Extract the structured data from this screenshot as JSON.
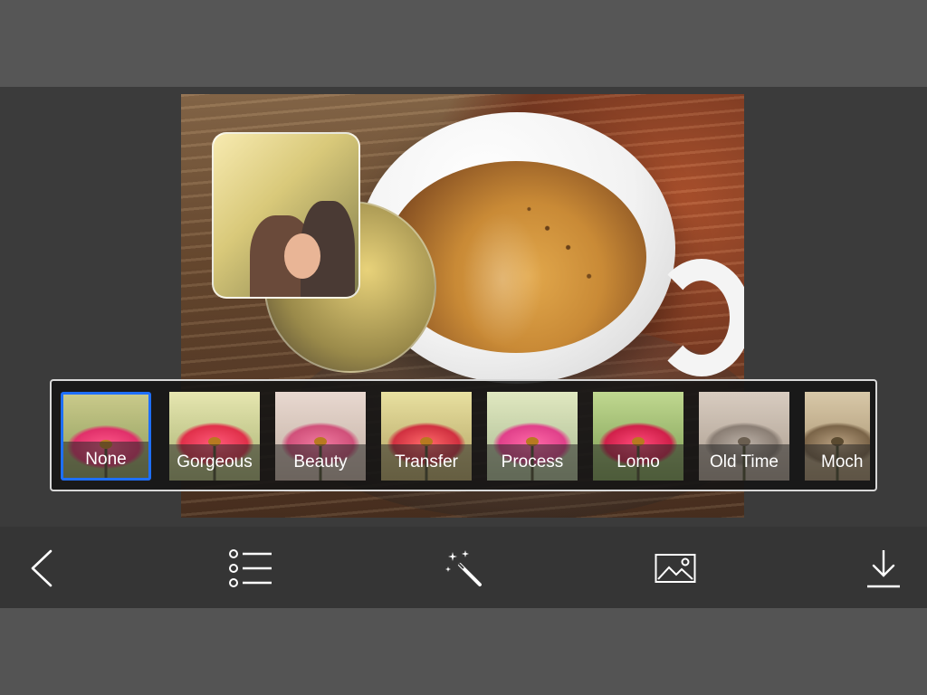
{
  "filters": [
    {
      "label": "None",
      "selected": true
    },
    {
      "label": "Gorgeous",
      "selected": false
    },
    {
      "label": "Beauty",
      "selected": false
    },
    {
      "label": "Transfer",
      "selected": false
    },
    {
      "label": "Process",
      "selected": false
    },
    {
      "label": "Lomo",
      "selected": false
    },
    {
      "label": "Old Time",
      "selected": false
    },
    {
      "label": "Moch",
      "selected": false
    }
  ],
  "toolbar": {
    "back": "back-arrow-icon",
    "list": "list-icon",
    "effects": "magic-wand-icon",
    "gallery": "image-icon",
    "save": "download-icon"
  },
  "colors": {
    "selection_border": "#1e6fff",
    "toolbar_bg": "#353535",
    "workspace_bg": "#3b3b3b"
  }
}
